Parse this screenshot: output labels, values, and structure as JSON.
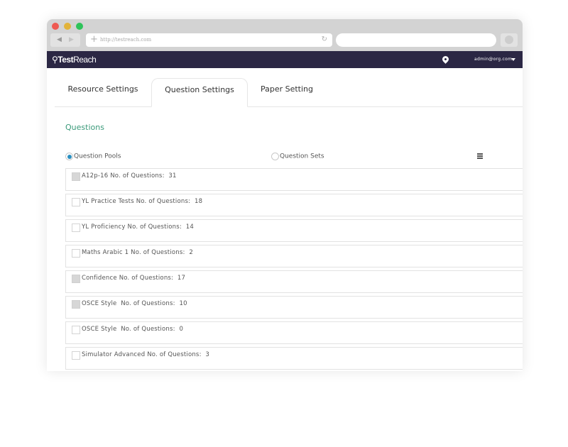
{
  "browser": {
    "url": "http://testreach.com",
    "back_icon": "back-arrow-icon",
    "forward_icon": "forward-arrow-icon",
    "reload_icon": "reload-icon"
  },
  "app": {
    "logo_bold": "Test",
    "logo_light": "Reach",
    "user_email": "admin@org.com"
  },
  "tabs": [
    {
      "label": "Resource Settings",
      "active": false
    },
    {
      "label": "Question Settings",
      "active": true
    },
    {
      "label": "Paper Setting",
      "active": false
    }
  ],
  "section": {
    "title": "Questions"
  },
  "source_options": [
    {
      "label": "Question Pools",
      "selected": true
    },
    {
      "label": "Question Sets",
      "selected": false
    }
  ],
  "items": [
    {
      "label": "A12p-16 No. of Questions:  31",
      "checked": false,
      "disabled": true
    },
    {
      "label": "YL Practice Tests No. of Questions:  18",
      "checked": false,
      "disabled": false
    },
    {
      "label": "YL Proficiency No. of Questions:  14",
      "checked": false,
      "disabled": false
    },
    {
      "label": "Maths Arabic 1 No. of Questions:  2",
      "checked": false,
      "disabled": false
    },
    {
      "label": "Confidence No. of Questions:  17",
      "checked": false,
      "disabled": true
    },
    {
      "label": "OSCE Style  No. of Questions:  10",
      "checked": false,
      "disabled": true
    },
    {
      "label": "OSCE Style  No. of Questions:  0",
      "checked": false,
      "disabled": false
    },
    {
      "label": "Simulator Advanced No. of Questions:  3",
      "checked": false,
      "disabled": false
    }
  ]
}
